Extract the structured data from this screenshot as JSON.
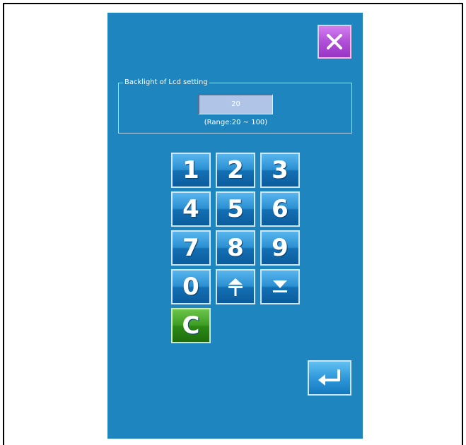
{
  "dialog": {
    "group_title": "Backlight of Lcd setting",
    "value": "20",
    "range": "(Range:20 ~ 100)"
  },
  "keypad": {
    "keys": [
      "1",
      "2",
      "3",
      "4",
      "5",
      "6",
      "7",
      "8",
      "9",
      "0"
    ],
    "clear": "C"
  },
  "icons": {
    "close": "close-icon",
    "increase": "increase-icon",
    "decrease": "decrease-icon",
    "enter": "enter-icon"
  },
  "colors": {
    "screen_bg": "#1f85be",
    "key_blue": "#2a8fd2",
    "key_green": "#3e9e24",
    "close_purple": "#b04fd8",
    "field_bg": "#afc4e6"
  }
}
